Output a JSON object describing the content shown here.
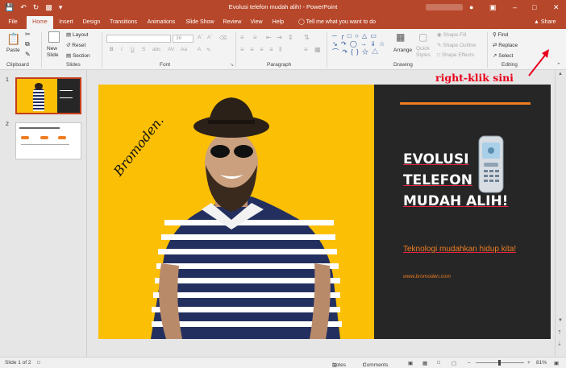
{
  "window": {
    "title": "Evolusi telefon mudah alih! - PowerPoint",
    "share_label": "Share",
    "tell_me": "Tell me what you want to do"
  },
  "colors": {
    "accent": "#b7472a",
    "slide_bg": "#fbbf06",
    "slide_dark": "#262626",
    "slide_orange": "#ee7d23",
    "annotation": "#e8001c"
  },
  "tabs": [
    {
      "label": "File"
    },
    {
      "label": "Home"
    },
    {
      "label": "Insert"
    },
    {
      "label": "Design"
    },
    {
      "label": "Transitions"
    },
    {
      "label": "Animations"
    },
    {
      "label": "Slide Show"
    },
    {
      "label": "Review"
    },
    {
      "label": "View"
    },
    {
      "label": "Help"
    }
  ],
  "active_tab": "Home",
  "ribbon": {
    "clipboard": {
      "paste": "Paste",
      "group": "Clipboard"
    },
    "slides": {
      "new_slide": "New Slide",
      "layout": "Layout",
      "reset": "Reset",
      "section": "Section",
      "group": "Slides"
    },
    "font": {
      "group": "Font",
      "size": "36"
    },
    "paragraph": {
      "group": "Paragraph"
    },
    "drawing": {
      "arrange": "Arrange",
      "quick_styles": "Quick Styles",
      "shape_fill": "Shape Fill",
      "shape_outline": "Shape Outline",
      "shape_effects": "Shape Effects",
      "group": "Drawing"
    },
    "editing": {
      "find": "Find",
      "replace": "Replace",
      "select": "Select",
      "group": "Editing"
    }
  },
  "thumbnails": [
    {
      "num": "1"
    },
    {
      "num": "2"
    }
  ],
  "slide": {
    "headline": [
      "EVOLUSI",
      "TELEFON",
      "MUDAH ALIH!"
    ],
    "subline": "Teknologi mudahkan hidup kita!",
    "url": "www.bromoden.com",
    "signature": "Bromoden."
  },
  "annotation": "right-klik sini",
  "status": {
    "slide_of": "Slide 1 of 2",
    "notes": "Notes",
    "comments": "Comments",
    "zoom": "81%"
  }
}
